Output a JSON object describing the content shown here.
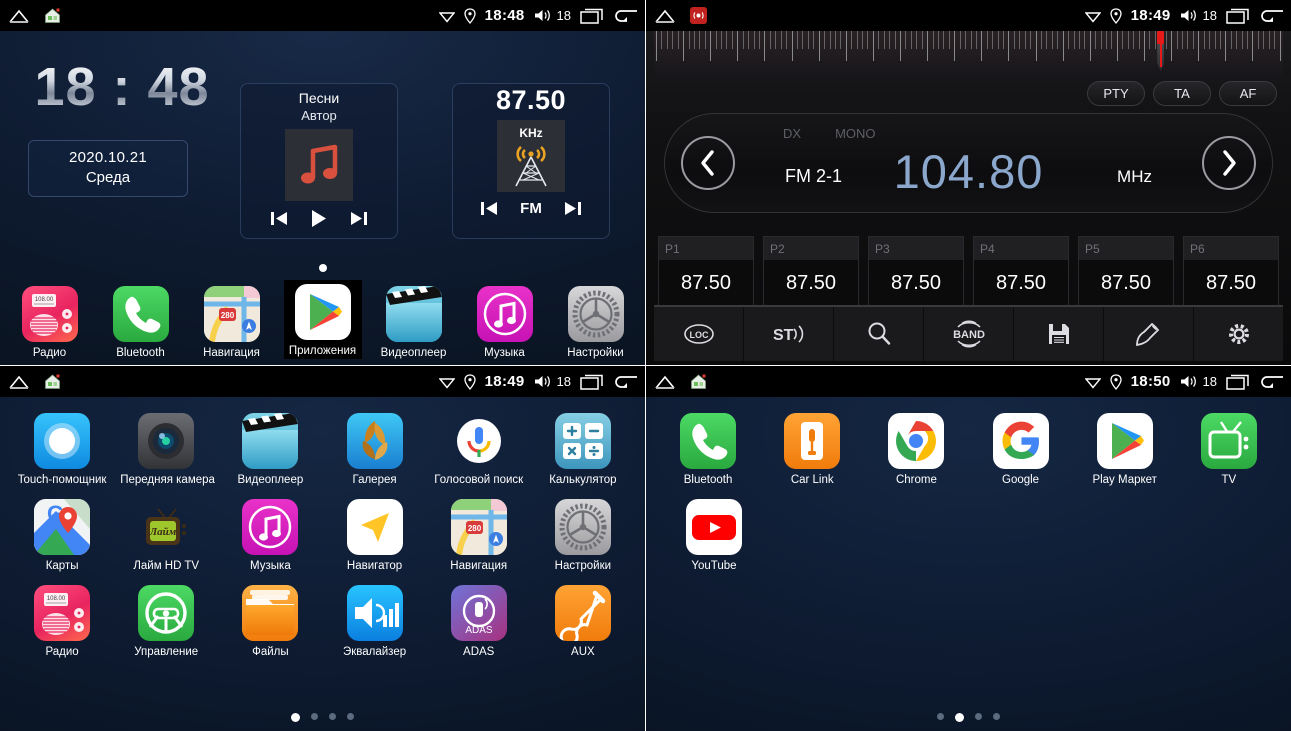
{
  "statusbar": {
    "home_icon": "home-outline-icon",
    "house_icon": "house-app-icon",
    "wifi_icon": "wifi-icon",
    "gps_icon": "location-pin-icon",
    "volume_icon": "volume-icon",
    "recents_icon": "recents-icon",
    "back_icon": "back-arrow-icon",
    "volume_value": "18",
    "times": {
      "home": "18:48",
      "radio": "18:49",
      "drawer1": "18:49",
      "drawer2": "18:50"
    }
  },
  "home": {
    "clock": "18 : 48",
    "date": "2020.10.21",
    "weekday": "Среда",
    "music_widget": {
      "title": "Песни",
      "artist": "Автор",
      "art_icon": "music-note-icon",
      "prev_icon": "previous-track-icon",
      "play_icon": "play-icon",
      "next_icon": "next-track-icon"
    },
    "radio_widget": {
      "frequency": "87.50",
      "unit": "KHz",
      "art_icon": "radio-tower-icon",
      "prev_icon": "previous-station-icon",
      "band": "FM",
      "next_icon": "next-station-icon"
    },
    "page_indicator": {
      "count": 1,
      "active": 0
    },
    "dock": [
      {
        "label": "Радио",
        "icon": "radio-app-icon"
      },
      {
        "label": "Bluetooth",
        "icon": "phone-app-icon"
      },
      {
        "label": "Навигация",
        "icon": "maps-app-icon"
      },
      {
        "label": "Приложения",
        "icon": "play-store-icon",
        "highlighted": true
      },
      {
        "label": "Видеоплеер",
        "icon": "video-player-icon"
      },
      {
        "label": "Музыка",
        "icon": "music-app-icon"
      },
      {
        "label": "Настройки",
        "icon": "settings-gear-icon"
      }
    ]
  },
  "radio": {
    "status_left_icon": "radio-red-icon",
    "rds_buttons": [
      {
        "label": "PTY"
      },
      {
        "label": "TA"
      },
      {
        "label": "AF"
      }
    ],
    "dx_label": "DX",
    "mono_label": "MONO",
    "band": "FM 2-1",
    "frequency": "104.80",
    "unit": "MHz",
    "prev_icon": "chevron-left-icon",
    "next_icon": "chevron-right-icon",
    "needle_position_pct": 80,
    "presets": [
      {
        "slot": "P1",
        "value": "87.50"
      },
      {
        "slot": "P2",
        "value": "87.50"
      },
      {
        "slot": "P3",
        "value": "87.50"
      },
      {
        "slot": "P4",
        "value": "87.50"
      },
      {
        "slot": "P5",
        "value": "87.50"
      },
      {
        "slot": "P6",
        "value": "87.50"
      }
    ],
    "toolbar": [
      {
        "name": "loc-button",
        "icon": "loc-icon"
      },
      {
        "name": "stereo-button",
        "icon": "stereo-icon"
      },
      {
        "name": "search-button",
        "icon": "search-icon"
      },
      {
        "name": "band-button",
        "icon": "band-icon"
      },
      {
        "name": "save-button",
        "icon": "floppy-save-icon"
      },
      {
        "name": "edit-button",
        "icon": "pen-edit-icon"
      },
      {
        "name": "settings-button",
        "icon": "gear-icon"
      }
    ]
  },
  "drawer_page1": {
    "rows": [
      [
        {
          "label": "Touch-помощник",
          "icon": "touch-assistant-icon"
        },
        {
          "label": "Передняя камера",
          "icon": "front-camera-icon"
        },
        {
          "label": "Видеоплеер",
          "icon": "video-player-icon"
        },
        {
          "label": "Галерея",
          "icon": "gallery-icon"
        },
        {
          "label": "Голосовой поиск",
          "icon": "voice-search-icon"
        },
        {
          "label": "Калькулятор",
          "icon": "calculator-icon"
        }
      ],
      [
        {
          "label": "Карты",
          "icon": "google-maps-icon"
        },
        {
          "label": "Лайм HD TV",
          "icon": "lime-hd-tv-icon"
        },
        {
          "label": "Музыка",
          "icon": "music-app-icon"
        },
        {
          "label": "Навигатор",
          "icon": "navigator-icon"
        },
        {
          "label": "Навигация",
          "icon": "maps-app-icon"
        },
        {
          "label": "Настройки",
          "icon": "settings-gear-icon"
        }
      ],
      [
        {
          "label": "Радио",
          "icon": "radio-app-icon"
        },
        {
          "label": "Управление",
          "icon": "steering-wheel-icon"
        },
        {
          "label": "Файлы",
          "icon": "files-folder-icon"
        },
        {
          "label": "Эквалайзер",
          "icon": "equalizer-icon"
        },
        {
          "label": "ADAS",
          "icon": "adas-icon"
        },
        {
          "label": "AUX",
          "icon": "aux-jack-icon"
        }
      ]
    ],
    "page_indicator": {
      "count": 4,
      "active": 0
    }
  },
  "drawer_page2": {
    "rows": [
      [
        {
          "label": "Bluetooth",
          "icon": "phone-app-icon"
        },
        {
          "label": "Car Link",
          "icon": "car-link-icon"
        },
        {
          "label": "Chrome",
          "icon": "chrome-icon"
        },
        {
          "label": "Google",
          "icon": "google-g-icon"
        },
        {
          "label": "Play Маркет",
          "icon": "play-store-icon"
        },
        {
          "label": "TV",
          "icon": "tv-icon"
        }
      ],
      [
        {
          "label": "YouTube",
          "icon": "youtube-icon"
        }
      ]
    ],
    "page_indicator": {
      "count": 4,
      "active": 1
    }
  },
  "colors": {
    "accent_blue": "#8ba7cc",
    "needle_red": "#e71a1a",
    "bg_dark_navy": "#0d1a30",
    "radio_bg": "#111113"
  }
}
